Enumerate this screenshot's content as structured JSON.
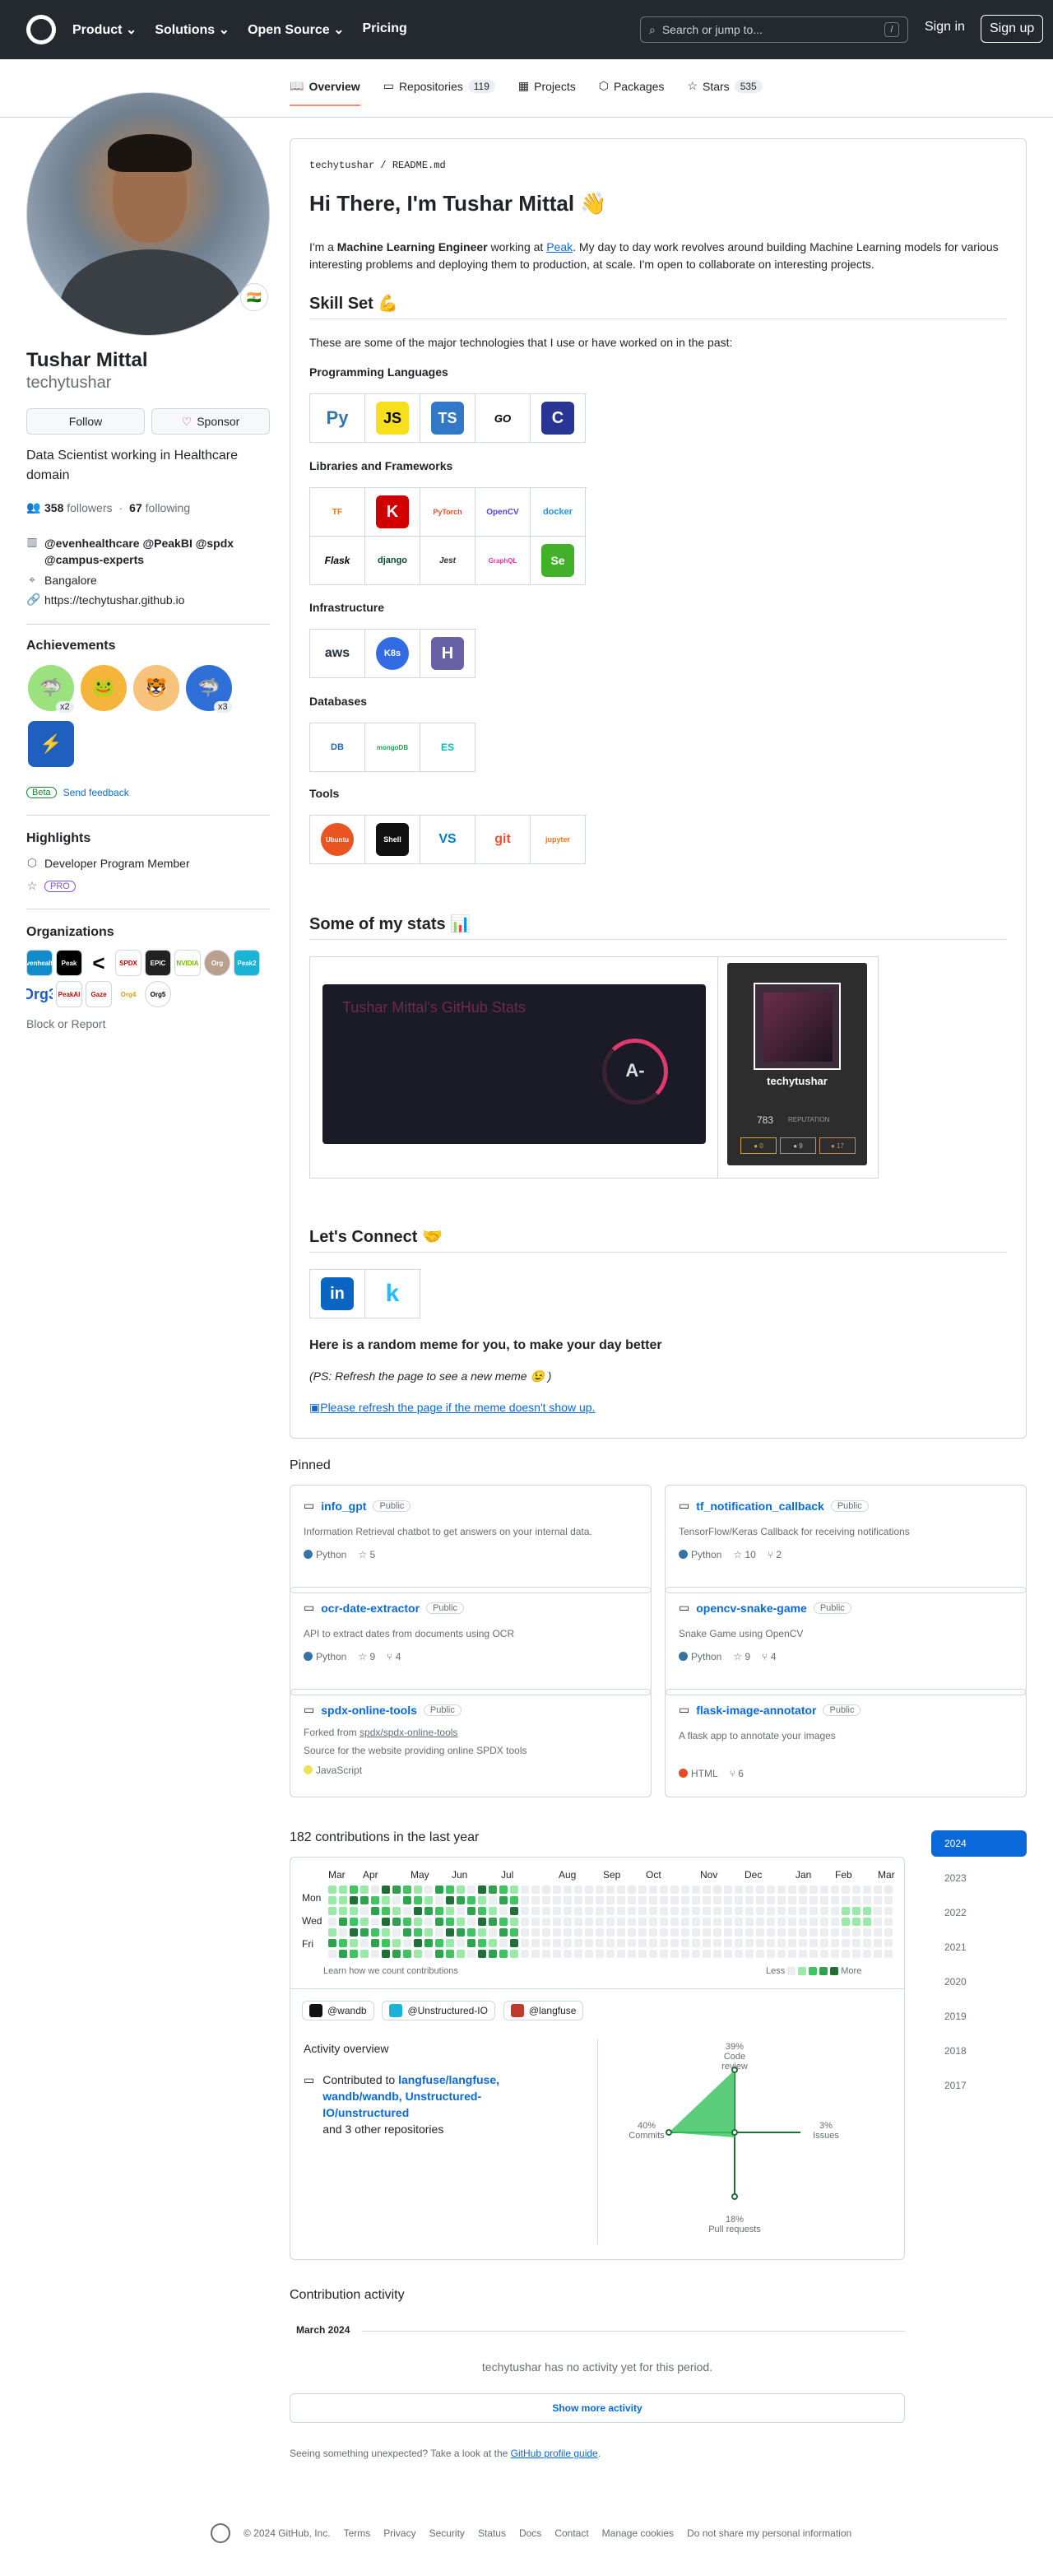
{
  "header": {
    "nav": [
      "Product",
      "Solutions",
      "Open Source",
      "Pricing"
    ],
    "search_placeholder": "Search or jump to...",
    "search_kbd": "/",
    "signin": "Sign in",
    "signup": "Sign up"
  },
  "tabs": [
    {
      "label": "Overview"
    },
    {
      "label": "Repositories",
      "count": "119"
    },
    {
      "label": "Projects"
    },
    {
      "label": "Packages"
    },
    {
      "label": "Stars",
      "count": "535"
    }
  ],
  "profile": {
    "flag": "🇮🇳",
    "name": "Tushar Mittal",
    "login": "techytushar",
    "follow": "Follow",
    "sponsor": "Sponsor",
    "bio": "Data Scientist working in Healthcare domain",
    "followers": "358",
    "followers_label": "followers",
    "following": "67",
    "following_label": "following",
    "sep": "·",
    "orgs_line1": "@evenhealthcare @PeakBI @spdx",
    "orgs_line2": "@campus-experts",
    "location": "Bangalore",
    "website": "https://techytushar.github.io"
  },
  "achievements": {
    "title": "Achievements",
    "badges": [
      {
        "emoji": "🦈",
        "count": "x2"
      },
      {
        "emoji": "🐸",
        "count": ""
      },
      {
        "emoji": "🐯",
        "count": ""
      },
      {
        "emoji": "🦈",
        "count": "x3"
      },
      {
        "emoji": "⚡",
        "count": ""
      }
    ],
    "beta": "Beta",
    "feedback": "Send feedback"
  },
  "highlights": {
    "title": "Highlights",
    "items": [
      "Developer Program Member",
      "PRO"
    ]
  },
  "organizations": {
    "title": "Organizations",
    "items": [
      "evenhealth",
      "Peak",
      "<",
      "SPDX",
      "EPIC",
      "NVIDIA",
      "Org",
      "Peak2",
      "Org3",
      "PeakAI",
      "Gaze",
      "Org4",
      "Org5"
    ],
    "block": "Block or Report"
  },
  "readme": {
    "path_user": "techytushar",
    "path_sep": "/",
    "path_file": "README.md",
    "title": "Hi There, I'm Tushar Mittal 👋",
    "intro_a": "I'm a ",
    "intro_bold": "Machine Learning Engineer",
    "intro_b": " working at ",
    "intro_link": "Peak",
    "intro_c": ". My day to day work revolves around building Machine Learning models for various interesting problems and deploying them to production, at scale. I'm open to collaborate on interesting projects.",
    "skill_title": "Skill Set 💪",
    "skill_intro": "These are some of the major technologies that I use or have worked on in the past:",
    "sections": [
      {
        "title": "Programming Languages",
        "logos": [
          "Py",
          "JS",
          "TS",
          "GO",
          "C"
        ]
      },
      {
        "title": "Libraries and Frameworks",
        "logos": [
          "TF",
          "K",
          "PyTorch",
          "OpenCV",
          "docker",
          "Flask",
          "django",
          "Jest",
          "GraphQL",
          "Se"
        ]
      },
      {
        "title": "Infrastructure",
        "logos": [
          "aws",
          "K8s",
          "H"
        ]
      },
      {
        "title": "Databases",
        "logos": [
          "DB",
          "mongoDB",
          "ES"
        ]
      },
      {
        "title": "Tools",
        "logos": [
          "Ubuntu",
          "Shell",
          "VS",
          "git",
          "jupyter"
        ]
      }
    ],
    "stats_title": "Some of my stats 📊",
    "gh_card_title": "Tushar Mittal's GitHub Stats",
    "gh_rank": "A-",
    "so_user": "techytushar",
    "so_rep": "783",
    "so_rep_label": "REPUTATION",
    "so_badges": [
      "● 0",
      "● 9",
      "● 17"
    ],
    "connect_title": "Let's Connect 🤝",
    "connect": [
      "in",
      "k"
    ],
    "meme_title": "Here is a random meme for you, to make your day better",
    "meme_note": "(PS: Refresh the page to see a new meme 😉 )",
    "meme_link": "Please refresh the page if the meme doesn't show up."
  },
  "pinned": {
    "title": "Pinned",
    "public": "Public",
    "items": [
      {
        "name": "info_gpt",
        "desc": "Information Retrieval chatbot to get answers on your internal data.",
        "lang": "Python",
        "color": "#3572A5",
        "stars": "5",
        "forks": ""
      },
      {
        "name": "tf_notification_callback",
        "desc": "TensorFlow/Keras Callback for receiving notifications",
        "lang": "Python",
        "color": "#3572A5",
        "stars": "10",
        "forks": "2"
      },
      {
        "name": "ocr-date-extractor",
        "desc": "API to extract dates from documents using OCR",
        "lang": "Python",
        "color": "#3572A5",
        "stars": "9",
        "forks": "4"
      },
      {
        "name": "opencv-snake-game",
        "desc": "Snake Game using OpenCV",
        "lang": "Python",
        "color": "#3572A5",
        "stars": "9",
        "forks": "4"
      },
      {
        "name": "spdx-online-tools",
        "fork_prefix": "Forked from ",
        "fork_link": "spdx/spdx-online-tools",
        "desc": "Source for the website providing online SPDX tools",
        "lang": "JavaScript",
        "color": "#f1e05a",
        "stars": "",
        "forks": ""
      },
      {
        "name": "flask-image-annotator",
        "desc": "A flask app to annotate your images",
        "lang": "HTML",
        "color": "#e34c26",
        "stars": "",
        "forks": "6"
      }
    ]
  },
  "contrib": {
    "title": "182 contributions in the last year",
    "months": [
      "Mar",
      "Apr",
      "May",
      "Jun",
      "Jul",
      "Aug",
      "Sep",
      "Oct",
      "Nov",
      "Dec",
      "Jan",
      "Feb",
      "Mar"
    ],
    "days": [
      "Mon",
      "Wed",
      "Fri"
    ],
    "learn": "Learn how we count contributions",
    "less": "Less",
    "more": "More",
    "years": [
      "2024",
      "2023",
      "2022",
      "2021",
      "2020",
      "2019",
      "2018",
      "2017"
    ],
    "chips": [
      "@wandb",
      "@Unstructured-IO",
      "@langfuse"
    ],
    "overview": "Activity overview",
    "contributed_to": "Contributed to ",
    "repos_links": "langfuse/langfuse, wandb/wandb, Unstructured-IO/unstructured",
    "repos_more": "and 3 other repositories",
    "radar": {
      "code_review": "39%",
      "code_review_label": "Code review",
      "commits": "40%",
      "commits_label": "Commits",
      "issues": "3%",
      "issues_label": "Issues",
      "prs": "18%",
      "prs_label": "Pull requests"
    }
  },
  "activity": {
    "title": "Contribution activity",
    "month": "March 2024",
    "empty": "techytushar has no activity yet for this period.",
    "more": "Show more activity",
    "profile_note": "Seeing something unexpected? Take a look at the ",
    "profile_link": "GitHub profile guide",
    "profile_end": "."
  },
  "footer": {
    "copy": "© 2024 GitHub, Inc.",
    "links": [
      "Terms",
      "Privacy",
      "Security",
      "Status",
      "Docs",
      "Contact",
      "Manage cookies",
      "Do not share my personal information"
    ]
  }
}
